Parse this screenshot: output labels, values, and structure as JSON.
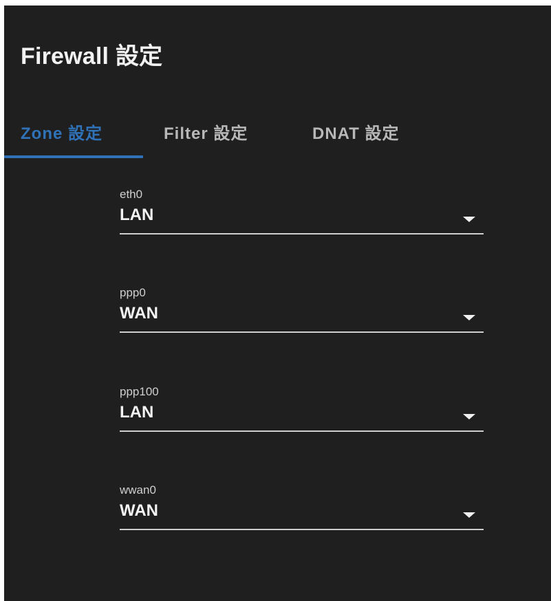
{
  "page": {
    "title": "Firewall 設定"
  },
  "tabs": {
    "zone": "Zone 設定",
    "filter": "Filter 設定",
    "dnat": "DNAT 設定",
    "active": "zone"
  },
  "zones": {
    "eth0": {
      "label": "eth0",
      "value": "LAN"
    },
    "ppp0": {
      "label": "ppp0",
      "value": "WAN"
    },
    "ppp100": {
      "label": "ppp100",
      "value": "LAN"
    },
    "wwan0": {
      "label": "wwan0",
      "value": "WAN"
    }
  },
  "icons": {
    "dropdown": "caret-down-icon"
  },
  "colors": {
    "background": "#1f1f1f",
    "accent": "#2f72b8",
    "inactive_tab": "#b8b8b8",
    "text": "#f4f4f4"
  }
}
